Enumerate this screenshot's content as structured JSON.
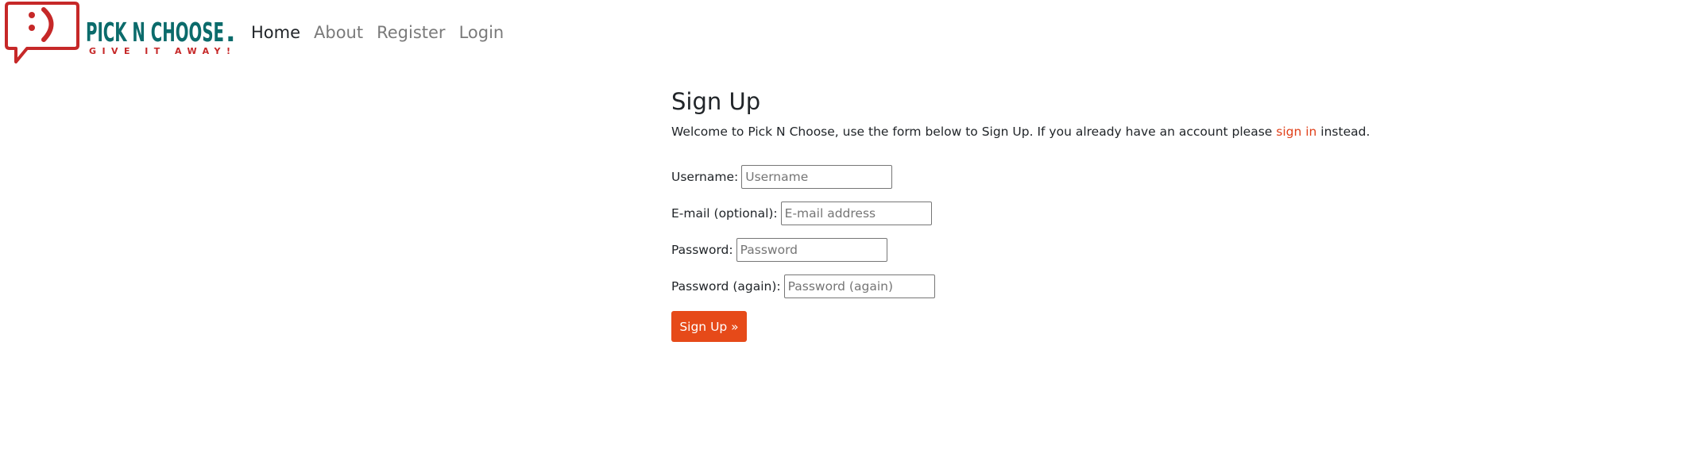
{
  "brand": {
    "logo_alt": "Pick N Choose logo",
    "name": "PICK N CHOOSE",
    "dot": ".",
    "tagline": "GIVE IT AWAY!",
    "colors": {
      "red": "#c62828",
      "teal": "#0b6b6b"
    }
  },
  "nav": {
    "items": [
      {
        "label": "Home",
        "active": true
      },
      {
        "label": "About",
        "active": false
      },
      {
        "label": "Register",
        "active": false
      },
      {
        "label": "Login",
        "active": false
      }
    ]
  },
  "signup": {
    "title": "Sign Up",
    "intro_before": "Welcome to Pick N Choose, use the form below to Sign Up. If you already have an account please ",
    "intro_link": "sign in",
    "intro_after": " instead.",
    "fields": {
      "username": {
        "label": "Username:",
        "placeholder": "Username",
        "value": ""
      },
      "email": {
        "label": "E-mail (optional):",
        "placeholder": "E-mail address",
        "value": ""
      },
      "password1": {
        "label": "Password:",
        "placeholder": "Password",
        "value": ""
      },
      "password2": {
        "label": "Password (again):",
        "placeholder": "Password (again)",
        "value": ""
      }
    },
    "submit_label": "Sign Up »"
  },
  "colors": {
    "accent": "#e64a19",
    "link": "#e0401a",
    "nav_active": "#212529",
    "nav_inactive": "#7a7a7a"
  }
}
